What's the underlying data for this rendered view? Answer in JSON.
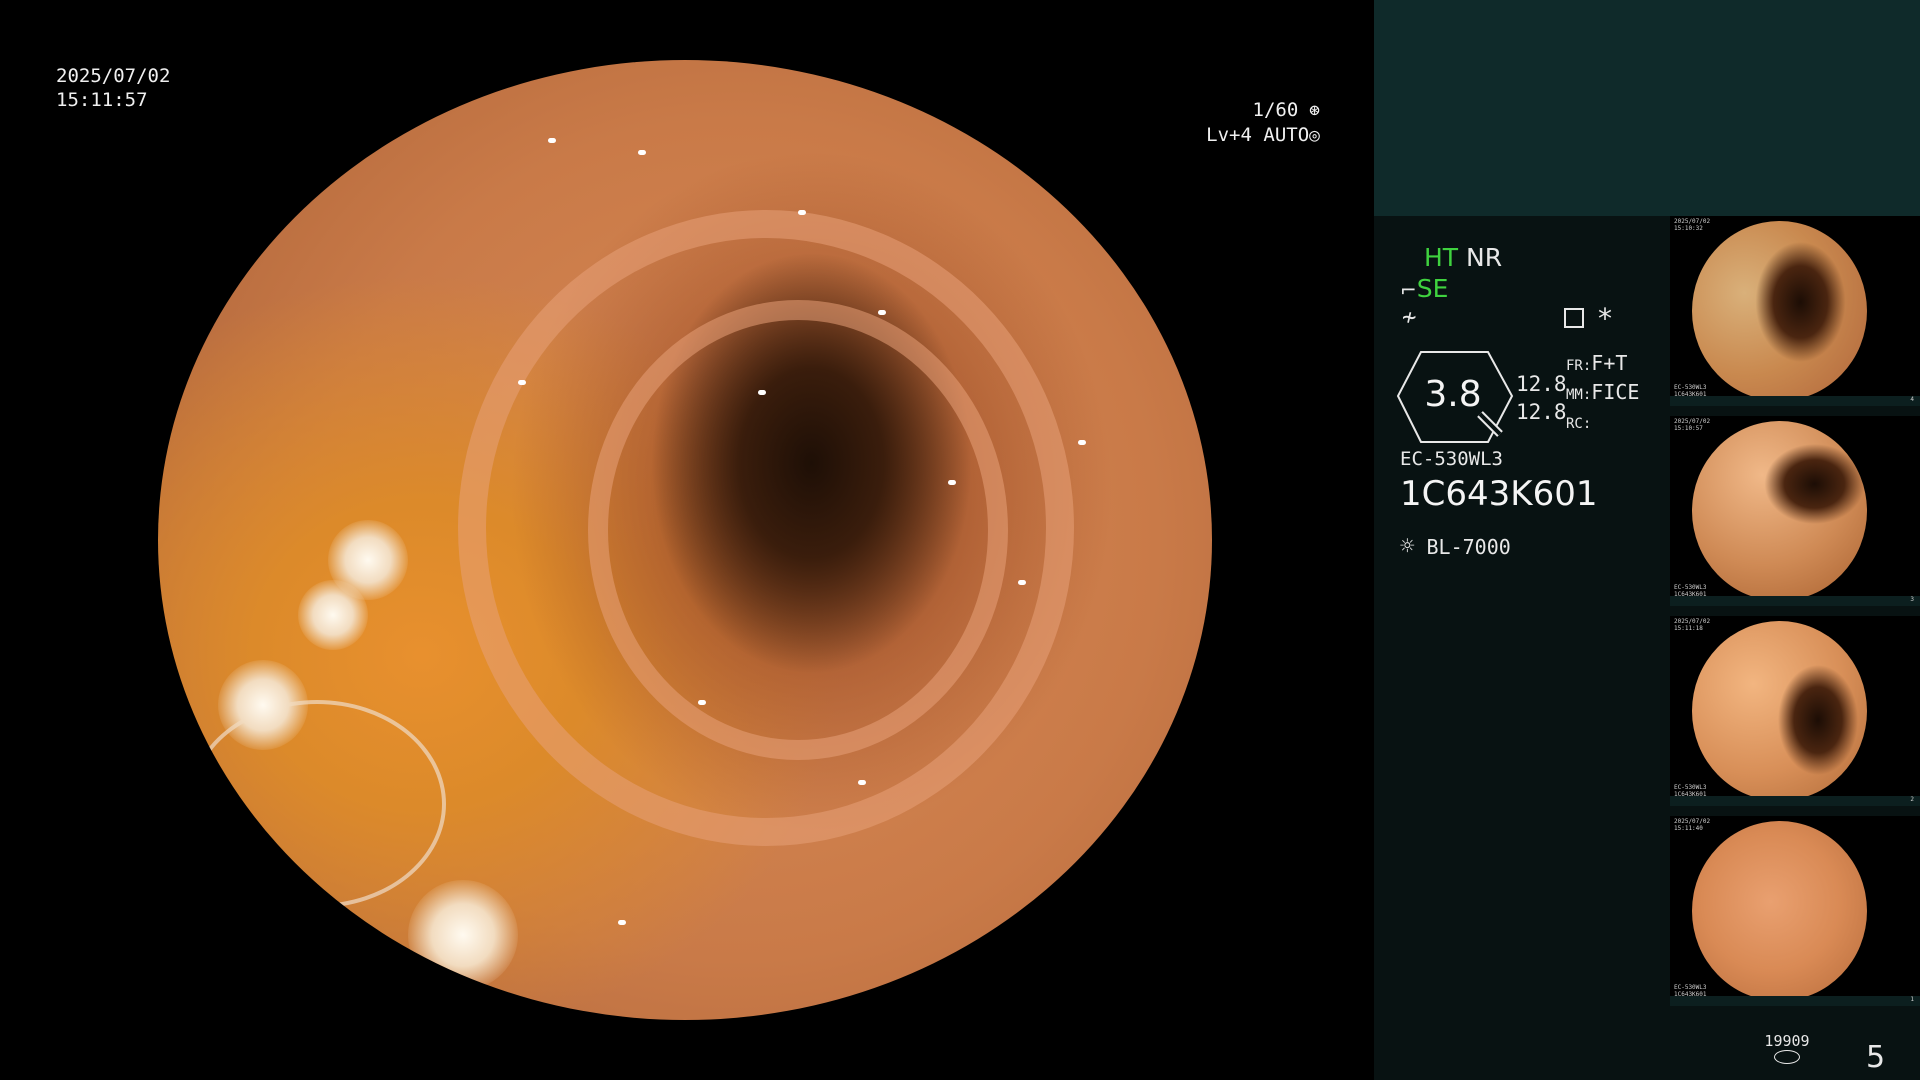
{
  "datetime": {
    "date": "2025/07/02",
    "time": "15:11:57"
  },
  "exposure": {
    "shutter": "1/60",
    "level": "Lv+4",
    "mode": "AUTO"
  },
  "modes": {
    "ht": "HT",
    "nr": "NR",
    "se": "SE"
  },
  "magnification": "3.8",
  "focus": {
    "value1": "12.8",
    "value2": "12.8"
  },
  "params": {
    "fr_label": "FR:",
    "fr_value": "F+T",
    "mm_label": "MM:",
    "mm_value": "FICE",
    "rc_label": "RC:",
    "rc_value": ""
  },
  "scope_model": "EC-530WL3",
  "scope_serial": "1C643K601",
  "light_source": "BL-7000",
  "storage_count": "19909",
  "image_count": "5",
  "thumbnails": [
    {
      "date": "2025/07/02",
      "time": "15:10:32",
      "model": "EC-530WL3",
      "serial": "1C643K601",
      "index": "4"
    },
    {
      "date": "2025/07/02",
      "time": "15:10:57",
      "model": "EC-530WL3",
      "serial": "1C643K601",
      "index": "3"
    },
    {
      "date": "2025/07/02",
      "time": "15:11:18",
      "model": "EC-530WL3",
      "serial": "1C643K601",
      "index": "2"
    },
    {
      "date": "2025/07/02",
      "time": "15:11:40",
      "model": "EC-530WL3",
      "serial": "1C643K601",
      "index": "1"
    }
  ],
  "icons": {
    "shutter": "aperture-icon",
    "auto": "iris-icon",
    "structure": "structure-enhance-icon",
    "contrast": "contrast-icon",
    "menu": "settings-list-icon",
    "star": "asterisk-icon",
    "zoom": "zoom-lens-icon",
    "light": "light-source-icon",
    "storage": "storage-disk-icon"
  },
  "colors": {
    "mode_active": "#3fd23f",
    "panel_top": "#0f2a2a",
    "panel": "#081212"
  }
}
